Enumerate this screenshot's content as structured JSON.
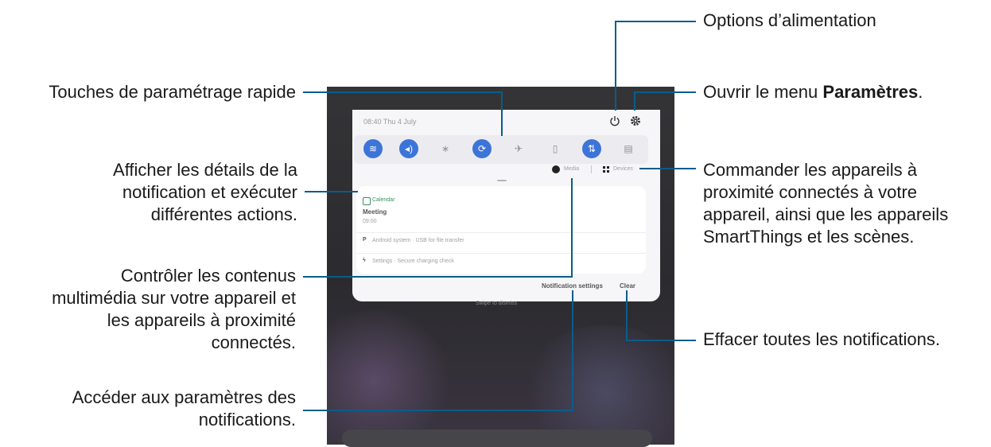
{
  "callouts": {
    "power_options": "Options d’alimentation",
    "open_settings_prefix": "Ouvrir le menu ",
    "open_settings_bold": "Paramètres",
    "open_settings_suffix": ".",
    "quick_settings": "Touches de paramétrage rapide",
    "notification_details_1": "Afficher les détails de la",
    "notification_details_2": "notification et exécuter",
    "notification_details_3": "différentes actions.",
    "devices_1": "Commander les appareils à",
    "devices_2": "proximité connectés à votre",
    "devices_3": "appareil, ainsi que les appareils",
    "devices_4": "SmartThings et les scènes.",
    "media_1": "Contrôler les contenus",
    "media_2": "multimédia sur votre appareil et",
    "media_3": "les appareils à proximité",
    "media_4": "connectés.",
    "clear_all": "Effacer toutes les notifications.",
    "notif_settings_1": "Accéder aux paramètres des",
    "notif_settings_2": "notifications."
  },
  "screen": {
    "status_time": "08:40  Thu 4 July",
    "media_label": "Media",
    "devices_label": "Devices",
    "calendar_app": "Calendar",
    "event_title": "Meeting",
    "event_time": "09:00",
    "android_system": "Android system · USB for file transfer",
    "settings_charging": "Settings · Secure charging check",
    "notification_settings": "Notification settings",
    "clear": "Clear",
    "no_notifications": "Swipe to dismiss"
  },
  "quick_settings_icons": [
    "wifi-icon",
    "sound-icon",
    "bluetooth-icon",
    "auto-rotate-icon",
    "airplane-icon",
    "power-saving-icon",
    "mobile-data-icon",
    "phone-icon"
  ],
  "colors": {
    "callout_line": "#0a5c8c",
    "toggle_on": "#3d74d8"
  }
}
